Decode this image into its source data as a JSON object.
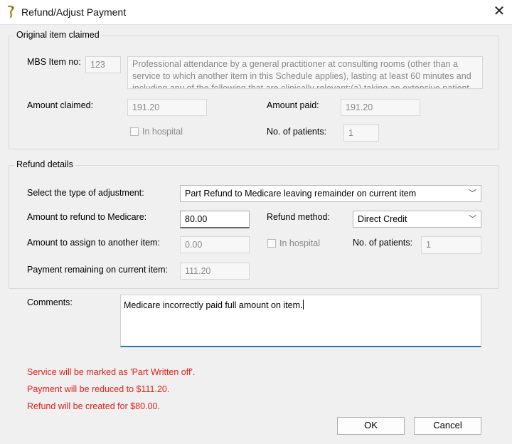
{
  "window": {
    "title": "Refund/Adjust Payment",
    "close_glyph": "✕"
  },
  "original_item": {
    "legend": "Original item claimed",
    "mbs_label": "MBS Item no:",
    "mbs_value": "123",
    "description": "Professional attendance by a general practitioner at consulting rooms (other than a service to which another item in this Schedule applies), lasting at least 60 minutes and including any of the following that are clinically relevant:(a) taking an extensive patient",
    "amount_claimed_label": "Amount claimed:",
    "amount_claimed": "191.20",
    "amount_paid_label": "Amount paid:",
    "amount_paid": "191.20",
    "in_hospital_label": "In hospital",
    "patients_label": "No. of patients:",
    "patients": "1"
  },
  "refund": {
    "legend": "Refund details",
    "adjust_type_label": "Select the type of adjustment:",
    "adjust_type": "Part Refund to Medicare leaving remainder on current item",
    "refund_amount_label": "Amount to refund to Medicare:",
    "refund_amount": "80.00",
    "refund_method_label": "Refund method:",
    "refund_method": "Direct Credit",
    "assign_label": "Amount to assign to another item:",
    "assign_value": "0.00",
    "in_hospital_label": "In hospital",
    "patients_label": "No. of patients:",
    "patients": "1",
    "remaining_label": "Payment remaining on current item:",
    "remaining_value": "111.20"
  },
  "comments": {
    "label": "Comments:",
    "value": "Medicare incorrectly paid full amount on item."
  },
  "messages": [
    "Service will be marked as 'Part Written off'.",
    "Payment will be reduced to $111.20.",
    "Refund will be created for $80.00."
  ],
  "buttons": {
    "ok": "OK",
    "cancel": "Cancel"
  },
  "icons": {
    "app": "app-icon",
    "chevron": "chevron-down-icon",
    "close": "close-icon"
  },
  "colors": {
    "warning_text": "#e0201a",
    "focus_underline": "#2a6fb8"
  }
}
